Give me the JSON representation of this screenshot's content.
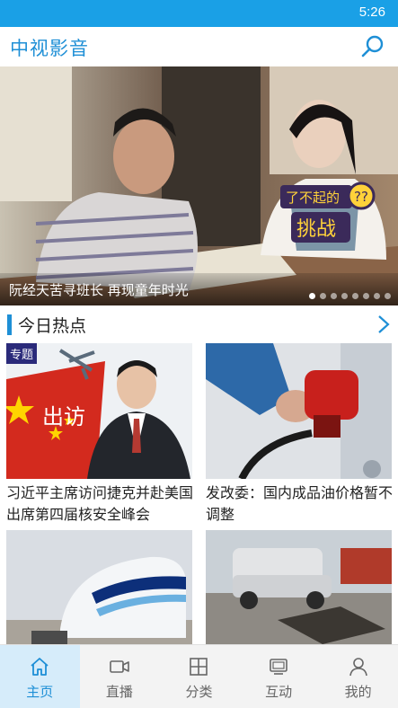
{
  "status_bar": {
    "time": "5:26"
  },
  "header": {
    "logo_text": "中视影音"
  },
  "colors": {
    "accent": "#1aa0e6",
    "brand": "#1e8fd6"
  },
  "hero": {
    "caption": "阮经天苦寻班长 再现童年时光",
    "badge_top": "了不起的",
    "badge_bottom": "挑战",
    "page_count": 8,
    "active_page": 1
  },
  "section": {
    "title": "今日热点"
  },
  "cards": [
    {
      "title": "习近平主席访问捷克并赴美国出席第四届核安全峰会",
      "tag": "专题",
      "image_text": "出访"
    },
    {
      "title": "发改委：国内成品油价格暂不调整"
    },
    {
      "title": ""
    },
    {
      "title": ""
    }
  ],
  "tabs": [
    {
      "label": "主页",
      "icon": "home-icon",
      "active": true
    },
    {
      "label": "直播",
      "icon": "camera-icon",
      "active": false
    },
    {
      "label": "分类",
      "icon": "grid-icon",
      "active": false
    },
    {
      "label": "互动",
      "icon": "chat-icon",
      "active": false
    },
    {
      "label": "我的",
      "icon": "user-icon",
      "active": false
    }
  ]
}
